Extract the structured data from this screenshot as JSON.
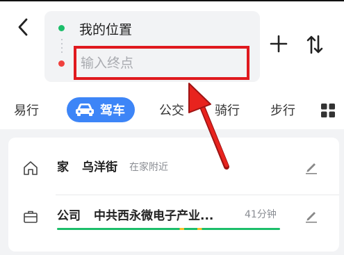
{
  "header": {
    "back_icon": "chevron-left-icon",
    "origin_label": "我的位置",
    "destination_placeholder": "输入终点",
    "add_icon": "plus-icon",
    "swap_icon": "swap-vertical-icon"
  },
  "modes": {
    "tabs": [
      {
        "label": "易行",
        "active": false
      },
      {
        "label": "驾车",
        "active": true,
        "icon": "car-icon"
      },
      {
        "label": "公交",
        "active": false
      },
      {
        "label": "骑行",
        "active": false
      },
      {
        "label": "步行",
        "active": false
      }
    ],
    "more_icon": "grid-icon"
  },
  "saved_places": [
    {
      "icon": "home-icon",
      "title": "家",
      "name": "乌洋街",
      "hint": "在家附近",
      "edit_icon": "edit-icon"
    },
    {
      "icon": "briefcase-icon",
      "title": "公司",
      "name": "中共西永微电子产业...",
      "eta": "41分钟",
      "edit_icon": "edit-icon"
    }
  ],
  "colors": {
    "accent": "#3d85f7",
    "origin_dot": "#1cbe6a",
    "destination_dot": "#f0413e",
    "highlight": "#e0191e",
    "traffic_green": "#1cbe6a",
    "traffic_yellow": "#f7c02b"
  }
}
